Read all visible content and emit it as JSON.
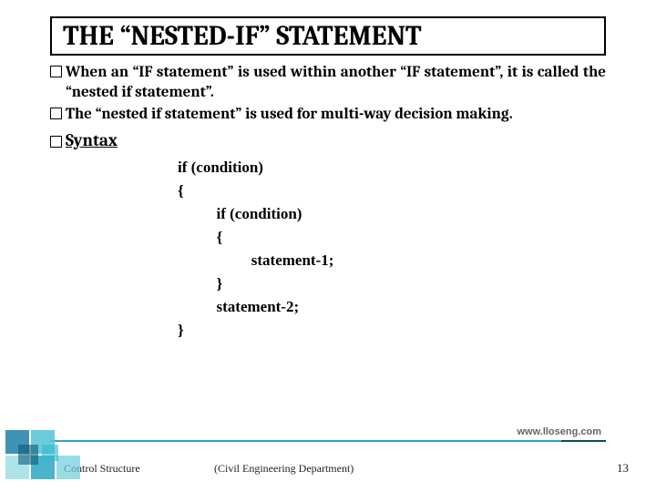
{
  "title": "THE “NESTED-IF” STATEMENT",
  "bullets": [
    "When an “IF statement” is used within another “IF statement”, it is called the “nested if statement”.",
    "The “nested if statement” is used for multi-way decision making."
  ],
  "syntax_label": "Syntax",
  "code": {
    "l1": "if (condition)",
    "l2": "{",
    "l3": "          if (condition)",
    "l4": "          {",
    "l5": "                   statement-1;",
    "l6": "          }",
    "l7": "          statement-2;",
    "l8": "}"
  },
  "lloseng": "www.lloseng.com",
  "footer_left": "Control Structure",
  "footer_center": "(Civil Engineering Department)",
  "page_number": "13"
}
